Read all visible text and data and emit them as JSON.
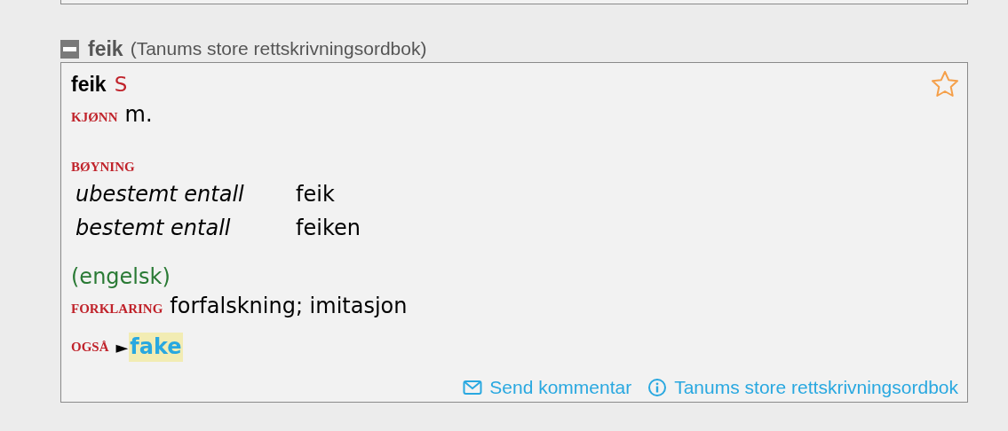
{
  "entry": {
    "expanded": true,
    "headword": "feik",
    "source": "(Tanums store rettskrivningsordbok)",
    "article": {
      "lemma": "feik",
      "lemma_mark": "S",
      "favorite": false,
      "gender_label": "KJØNN",
      "gender": "m.",
      "inflection_label": "BØYNING",
      "inflection": [
        {
          "form_name": "ubestemt entall",
          "form": "feik"
        },
        {
          "form_name": "bestemt entall",
          "form": "feiken"
        }
      ],
      "origin": "(engelsk)",
      "definition_label": "FORKLARING",
      "definition": "forfalskning; imitasjon",
      "see_also_label": "OGSÅ",
      "see_also_marker": "►",
      "see_also_link": "fake",
      "see_also_highlighted": true
    },
    "footer_links": [
      {
        "kind": "mail",
        "label": "Send kommentar"
      },
      {
        "kind": "info",
        "label": "Tanums store rettskrivningsordbok"
      }
    ]
  }
}
